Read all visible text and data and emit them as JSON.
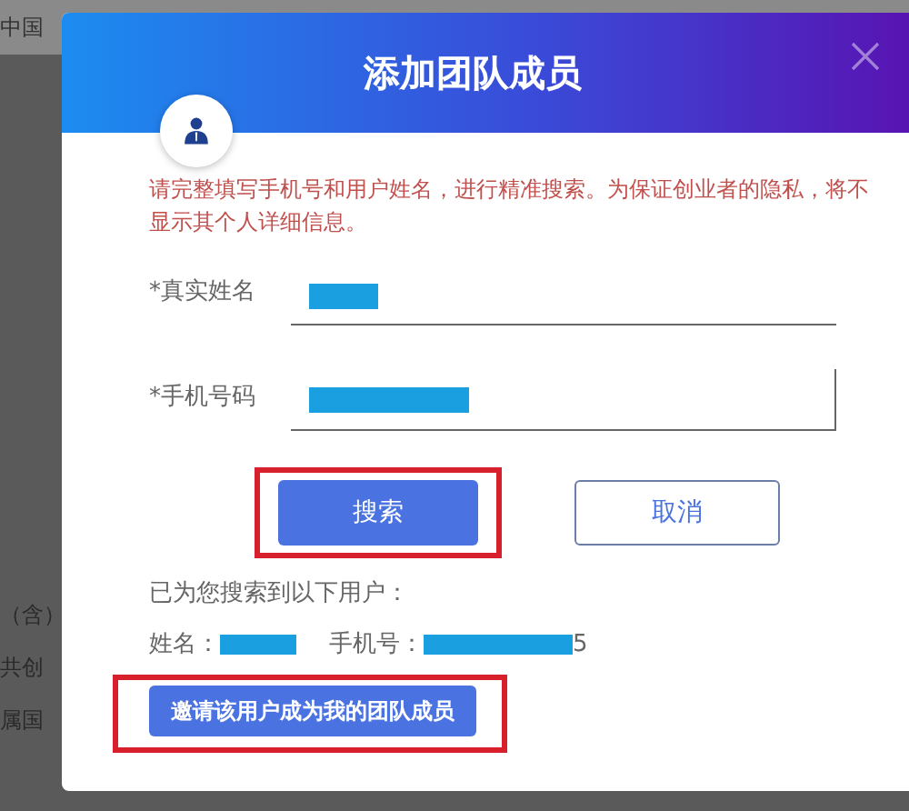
{
  "background_page": {
    "texts": [
      "中国",
      "（含）",
      "共创",
      "属国"
    ]
  },
  "dialog": {
    "title": "添加团队成员",
    "notice": "请完整填写手机号和用户姓名，进行精准搜索。为保证创业者的隐私，将不显示其个人详细信息。",
    "fields": [
      {
        "label": "*真实姓名",
        "masked": true,
        "kind": "underline"
      },
      {
        "label": "*手机号码",
        "masked": true,
        "kind": "boxed"
      }
    ],
    "buttons": [
      {
        "label": "搜索",
        "kind": "primary",
        "highlighted": true
      },
      {
        "label": "取消",
        "kind": "secondary",
        "highlighted": false
      }
    ],
    "result": {
      "heading": "已为您搜索到以下用户：",
      "name_label": "姓名：",
      "name_masked": true,
      "phone_label": "手机号：",
      "phone_masked": true,
      "phone_tail": "5"
    },
    "invite_button": {
      "label": "邀请该用户成为我的团队成员",
      "highlighted": true
    }
  }
}
